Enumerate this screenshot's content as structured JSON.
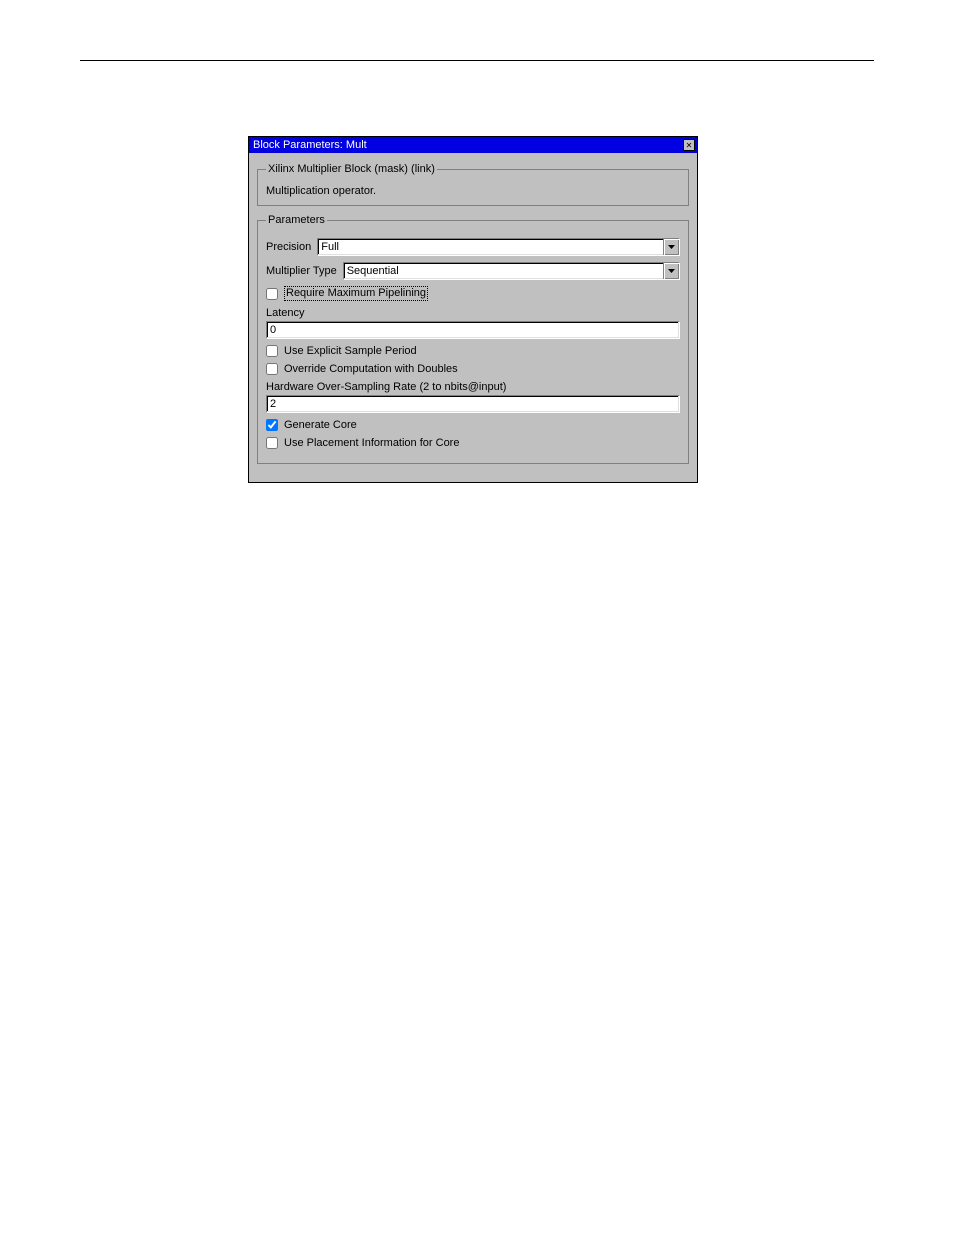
{
  "dialog": {
    "title": "Block Parameters: Mult",
    "header": {
      "legend": "Xilinx Multiplier Block (mask) (link)",
      "description": "Multiplication operator."
    },
    "params": {
      "legend": "Parameters",
      "precision_label": "Precision",
      "precision_value": "Full",
      "multtype_label": "Multiplier Type",
      "multtype_value": "Sequential",
      "require_max_pipe": {
        "label": "Require Maximum Pipelining",
        "checked": false
      },
      "latency_label": "Latency",
      "latency_value": "0",
      "use_explicit_sp": {
        "label": "Use Explicit Sample Period",
        "checked": false
      },
      "override_doubles": {
        "label": "Override Computation with Doubles",
        "checked": false
      },
      "hw_oversampling_label": "Hardware Over-Sampling Rate (2 to nbits@input)",
      "hw_oversampling_value": "2",
      "generate_core": {
        "label": "Generate Core",
        "checked": true
      },
      "use_placement": {
        "label": "Use Placement Information for Core",
        "checked": false
      }
    }
  }
}
